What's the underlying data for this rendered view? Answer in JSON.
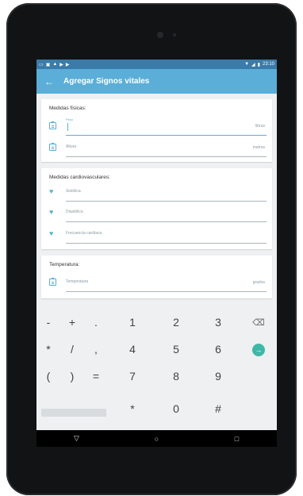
{
  "status": {
    "left_icons": [
      "notification-icon",
      "image-icon",
      "lock-icon",
      "play-icon",
      "play-icon"
    ],
    "time": "23:10"
  },
  "appbar": {
    "title": "Agregar Signos vitales"
  },
  "physical": {
    "title": "Medidas físicas:",
    "weight": {
      "label": "Peso",
      "unit": "libras"
    },
    "height": {
      "placeholder": "Altura",
      "unit": "metros"
    }
  },
  "cardio": {
    "title": "Medidas cardiovasculares:",
    "fields": [
      "Sistólica",
      "Diastólica",
      "Frecuencia cardíaca"
    ]
  },
  "temperature": {
    "title": "Temperatura:",
    "field": {
      "placeholder": "Temperatura",
      "unit": "grados"
    }
  },
  "keyboard": {
    "rows": [
      [
        "-",
        "+",
        ".",
        "1",
        "2",
        "3",
        "⌫"
      ],
      [
        "*",
        "/",
        ",",
        "4",
        "5",
        "6",
        "→"
      ],
      [
        "(",
        ")",
        "=",
        "7",
        "8",
        "9",
        ""
      ],
      [
        "",
        "",
        "",
        "*",
        "0",
        "#",
        ""
      ]
    ]
  },
  "navbar": {
    "back": "▽",
    "home": "○",
    "recents": "□"
  },
  "colors": {
    "accent": "#5aaed8",
    "statusbar": "#3a7ba9"
  }
}
